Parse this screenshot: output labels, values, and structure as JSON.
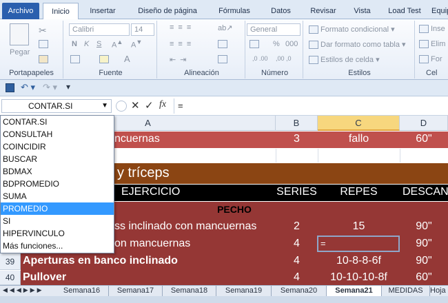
{
  "ribbon_tabs": [
    "Archivo",
    "Inicio",
    "Insertar",
    "Diseño de página",
    "Fórmulas",
    "Datos",
    "Revisar",
    "Vista",
    "Load Test",
    "Equipo"
  ],
  "clipboard": {
    "paste": "Pegar",
    "label": "Portapapeles"
  },
  "font": {
    "name": "Calibri",
    "size": "14",
    "bold": "N",
    "italic": "K",
    "underline": "S",
    "label": "Fuente"
  },
  "alignment": {
    "label": "Alineación"
  },
  "number": {
    "format": "General",
    "percent": "%",
    "thousands": "000",
    "label": "Número"
  },
  "styles": {
    "conditional": "Formato condicional",
    "table": "Dar formato como tabla",
    "cell": "Estilos de celda",
    "label": "Estilos"
  },
  "cells": {
    "insert": "Inse",
    "delete": "Elim",
    "format": "For",
    "label": "Cel"
  },
  "formula_bar": {
    "name_box": "CONTAR.SI",
    "fx": "fx",
    "content": "="
  },
  "autocomplete": {
    "items": [
      "CONTAR.SI",
      "CONSULTAH",
      "COINCIDIR",
      "BUSCAR",
      "BDMAX",
      "BDPROMEDIO",
      "SUMA",
      "PROMEDIO",
      "SI",
      "HIPERVINCULO",
      "Más funciones..."
    ],
    "highlighted": "PROMEDIO"
  },
  "columns": [
    "A",
    "B",
    "C",
    "D"
  ],
  "sheet": {
    "row_top": {
      "a": "ncuernas",
      "b": "3",
      "c": "fallo",
      "d": "60\""
    },
    "section_title": "y tríceps",
    "headers": {
      "a": "EJERCICIO",
      "b": "SERIES",
      "c": "REPES",
      "d": "DESCANS"
    },
    "group": "PECHO",
    "rows": [
      {
        "num": "",
        "a": "ss inclinado con mancuernas",
        "b": "2",
        "c": "15",
        "d": "90\""
      },
      {
        "num": "",
        "a": "on mancuernas",
        "b": "4",
        "c": "=",
        "d": "90\""
      },
      {
        "num": "39",
        "a": "Aperturas en banco inclinado",
        "b": "4",
        "c": "10-8-8-6f",
        "d": "90\""
      },
      {
        "num": "40",
        "a": "Pullover",
        "b": "4",
        "c": "10-10-10-8f",
        "d": "60\""
      }
    ]
  },
  "sheet_tabs": [
    "Semana16",
    "Semana17",
    "Semana18",
    "Semana19",
    "Semana20",
    "Semana21",
    "MEDIDAS",
    "Hoja"
  ],
  "active_sheet": "Semana21",
  "colors": {
    "row_top": "#c0504d",
    "section": "#8b4513",
    "header": "#000000",
    "body": "#953735"
  }
}
